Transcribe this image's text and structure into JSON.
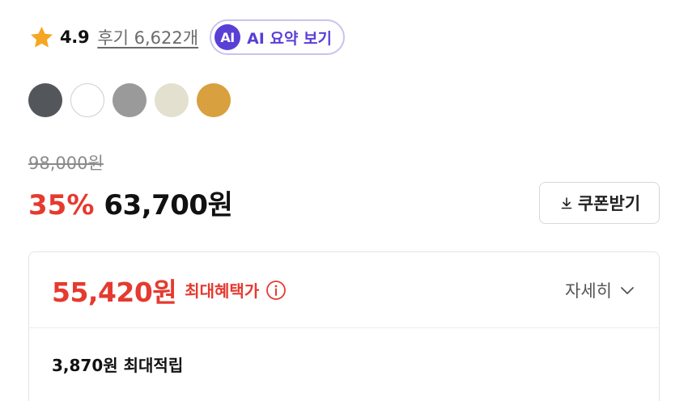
{
  "rating": {
    "score": "4.9",
    "review_label": "후기 6,622개",
    "star_color": "#f5a623"
  },
  "ai_summary": {
    "badge": "AI",
    "label": "AI 요약 보기",
    "accent_color": "#5a3fd6"
  },
  "color_options": [
    {
      "name": "charcoal",
      "color": "#53575c"
    },
    {
      "name": "white",
      "color": "#ffffff"
    },
    {
      "name": "gray",
      "color": "#9a9a9a"
    },
    {
      "name": "cream",
      "color": "#e3e0cf"
    },
    {
      "name": "gold",
      "color": "#d8a03e"
    }
  ],
  "price": {
    "original": "98,000원",
    "discount_rate": "35%",
    "sale": "63,700원",
    "accent_color": "#e53a2f"
  },
  "coupon": {
    "label": "쿠폰받기",
    "icon": "download-icon"
  },
  "benefit": {
    "max_price": "55,420원",
    "max_label": "최대혜택가",
    "info_icon": "info-icon",
    "details_label": "자세히",
    "details_icon": "chevron-down-icon",
    "points": "3,870원 최대적립"
  }
}
